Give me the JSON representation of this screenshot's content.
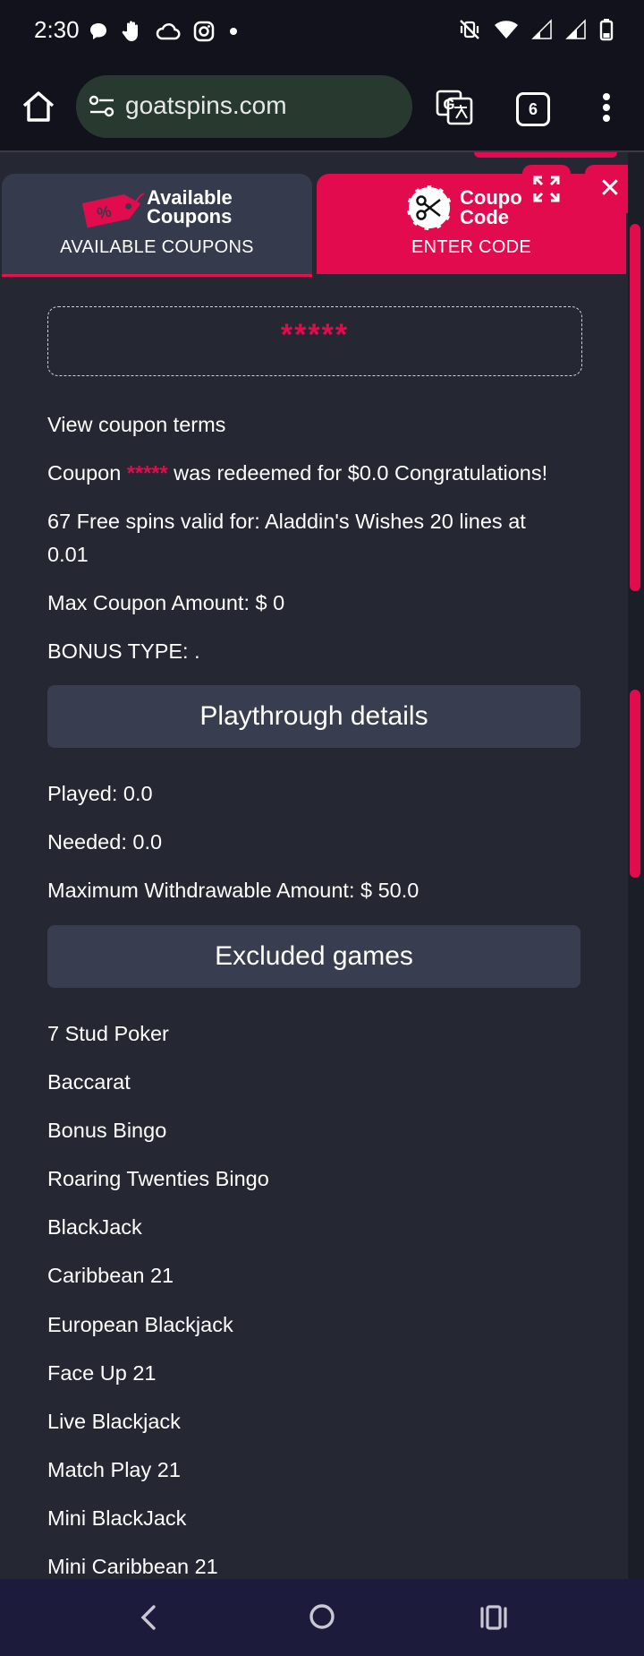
{
  "status_bar": {
    "time": "2:30",
    "left_icons": [
      "chat-bubble-icon",
      "hand-icon",
      "cloud-icon",
      "instagram-icon",
      "dot-icon"
    ],
    "right_icons": [
      "mute-vibrate-icon",
      "wifi-icon",
      "signal-icon",
      "signal-icon",
      "battery-icon"
    ]
  },
  "browser": {
    "url": "goatspins.com",
    "tab_count": "6"
  },
  "tabs": {
    "available": {
      "title_line1": "Available",
      "title_line2": "Coupons",
      "caption": "AVAILABLE COUPONS"
    },
    "code": {
      "title_line1": "Coupon",
      "title_line2": "Code",
      "caption": "ENTER CODE"
    }
  },
  "coupon": {
    "code_value": "*****",
    "view_terms": "View coupon terms",
    "redeemed_prefix": "Coupon",
    "redeemed_code": "*****",
    "redeemed_suffix": "was redeemed for $0.0 Congratulations!",
    "free_spins_line1": "67 Free spins valid for: Aladdin's Wishes 20 lines at",
    "free_spins_line2": "0.01",
    "max_amount": "Max Coupon Amount: $ 0",
    "bonus_type": "BONUS TYPE: ."
  },
  "playthrough": {
    "header": "Playthrough details",
    "played": "Played: 0.0",
    "needed": "Needed: 0.0",
    "max_withdrawable": "Maximum Withdrawable Amount: $ 50.0"
  },
  "excluded": {
    "header": "Excluded games",
    "games": [
      "7 Stud Poker",
      "Baccarat",
      "Bonus Bingo",
      "Roaring Twenties Bingo",
      "BlackJack",
      "Caribbean 21",
      "European Blackjack",
      "Face Up 21",
      "Live Blackjack",
      "Match Play 21",
      "Mini BlackJack",
      "Mini Caribbean 21"
    ]
  },
  "colors": {
    "accent": "#e20b4d",
    "background": "#252833",
    "section_bar": "#393d50",
    "browser_bar": "#12121c",
    "nav_bar": "#1d1b3c"
  }
}
